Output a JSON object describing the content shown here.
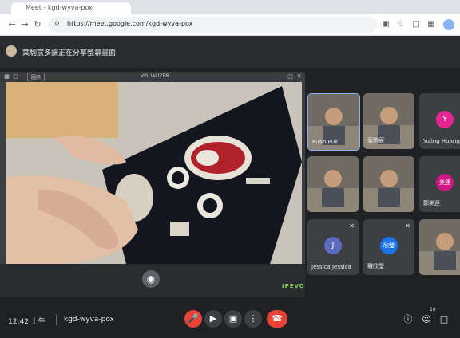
{
  "browser": {
    "tab_title": "Meet - kgd-wyva-pox",
    "url": "https://meet.google.com/kgd-wyva-pox"
  },
  "meet": {
    "presenting_text": "葉駒宸多讀正在分享螢幕畫面",
    "visualizer_title": "VISUALIZER",
    "visualizer_mode": "圖示",
    "camera_brand": "IPEVO",
    "tiles": [
      {
        "name": "Kuan Puk",
        "avatar_letter": "",
        "avatar_color": "#6b6f73",
        "type": "video"
      },
      {
        "name": "葉駒宸",
        "avatar_letter": "",
        "avatar_color": "#6b6f73",
        "type": "video"
      },
      {
        "name": "Yuling Huang",
        "avatar_letter": "Y",
        "avatar_color": "#e52592",
        "type": "avatar"
      },
      {
        "name": "",
        "avatar_letter": "",
        "avatar_color": "#6b6f73",
        "type": "video"
      },
      {
        "name": "",
        "avatar_letter": "",
        "avatar_color": "#6b6f73",
        "type": "video"
      },
      {
        "name": "鄭美連",
        "avatar_letter": "美連",
        "avatar_color": "#d01884",
        "type": "avatar"
      },
      {
        "name": "Jessica Jessica",
        "avatar_letter": "J",
        "avatar_color": "#5c6bc0",
        "type": "avatar"
      },
      {
        "name": "羅欣瑩",
        "avatar_letter": "欣瑩",
        "avatar_color": "#1a73e8",
        "type": "avatar"
      },
      {
        "name": "",
        "avatar_letter": "",
        "avatar_color": "#6b6f73",
        "type": "video"
      }
    ],
    "bottom": {
      "time": "12:42 上午",
      "meeting_code": "kgd-wyva-pox",
      "participant_count": "10"
    }
  }
}
